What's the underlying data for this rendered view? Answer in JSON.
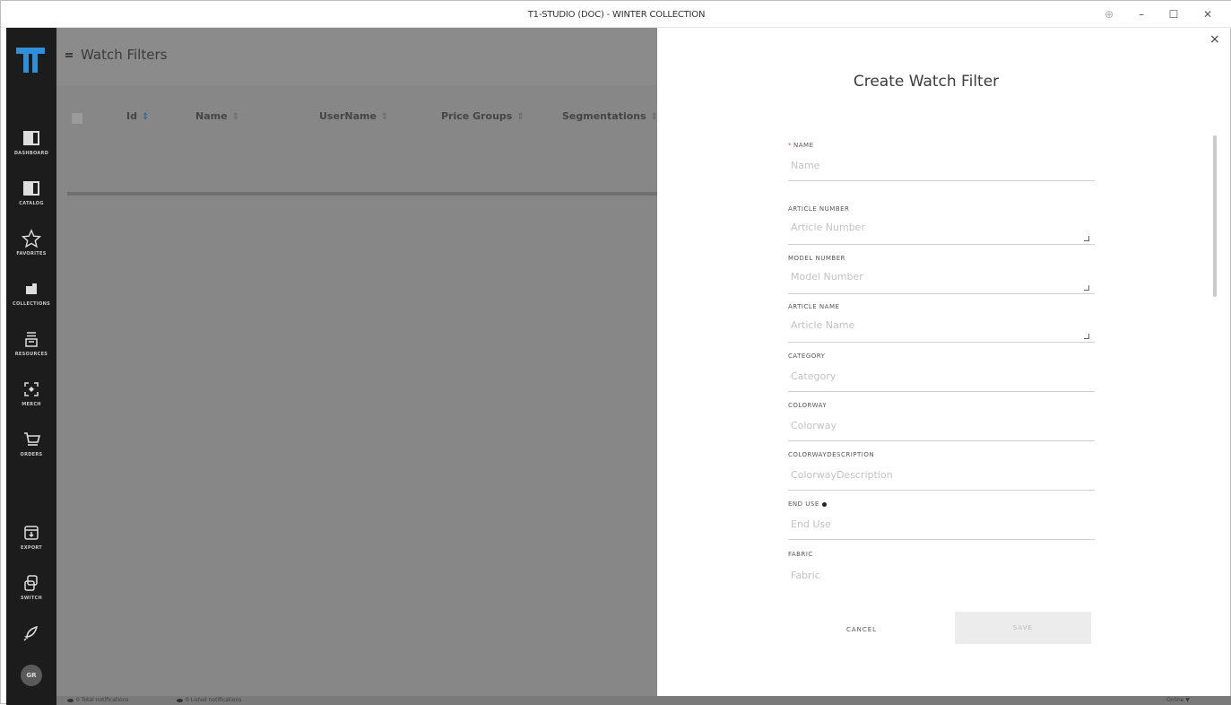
{
  "window": {
    "title": "T1-STUDIO (DOC) - WINTER COLLECTION",
    "controls": {
      "zoom": "⊕",
      "minimize": "–",
      "maximize": "☐",
      "close": "✕"
    }
  },
  "sidebar": {
    "items": [
      {
        "label": "DASHBOARD",
        "icon": "book-icon"
      },
      {
        "label": "CATALOG",
        "icon": "book-icon"
      },
      {
        "label": "FAVORITES",
        "icon": "star-icon"
      },
      {
        "label": "COLLECTIONS",
        "icon": "folder-icon"
      },
      {
        "label": "RESOURCES",
        "icon": "drawer-icon"
      },
      {
        "label": "MERCH",
        "icon": "merch-icon"
      },
      {
        "label": "ORDERS",
        "icon": "cart-icon"
      },
      {
        "label": "EXPORT",
        "icon": "export-icon"
      },
      {
        "label": "SWITCH",
        "icon": "switch-icon"
      }
    ],
    "feedback_icon": "rocket-icon",
    "avatar": "GR"
  },
  "main": {
    "title": "Watch Filters",
    "columns": [
      {
        "label": "Id",
        "sort": "⇕",
        "active": true
      },
      {
        "label": "Name",
        "sort": "⇕"
      },
      {
        "label": "UserName",
        "sort": "⇕"
      },
      {
        "label": "Price Groups",
        "sort": "⇕"
      },
      {
        "label": "Segmentations",
        "sort": "⇕"
      }
    ]
  },
  "status": {
    "total_notifications": "0 Total notifications",
    "listed_notifications": "0 Listed notifications",
    "online": "Online"
  },
  "panel": {
    "heading": "Create Watch Filter",
    "close": "×",
    "fields": {
      "name": {
        "label": "NAME",
        "placeholder": "Name",
        "required": true
      },
      "article_number": {
        "label": "ARTICLE NUMBER",
        "placeholder": "Article Number"
      },
      "model_number": {
        "label": "MODEL NUMBER",
        "placeholder": "Model Number"
      },
      "article_name": {
        "label": "ARTICLE NAME",
        "placeholder": "Article Name"
      },
      "category": {
        "label": "CATEGORY",
        "placeholder": "Category"
      },
      "colorway": {
        "label": "COLORWAY",
        "placeholder": "Colorway"
      },
      "colorway_description": {
        "label": "COLORWAYDESCRIPTION",
        "placeholder": "ColorwayDescription"
      },
      "end_use": {
        "label": "END USE",
        "placeholder": "End Use"
      },
      "fabric": {
        "label": "FABRIC",
        "placeholder": "Fabric"
      }
    },
    "cancel_label": "CANCEL",
    "save_label": "SAVE"
  },
  "colors": {
    "sidebar_bg": "#1c1c1c",
    "overlay": "#878787",
    "logo": "#2f8fd8",
    "required": "#e04a3a"
  }
}
